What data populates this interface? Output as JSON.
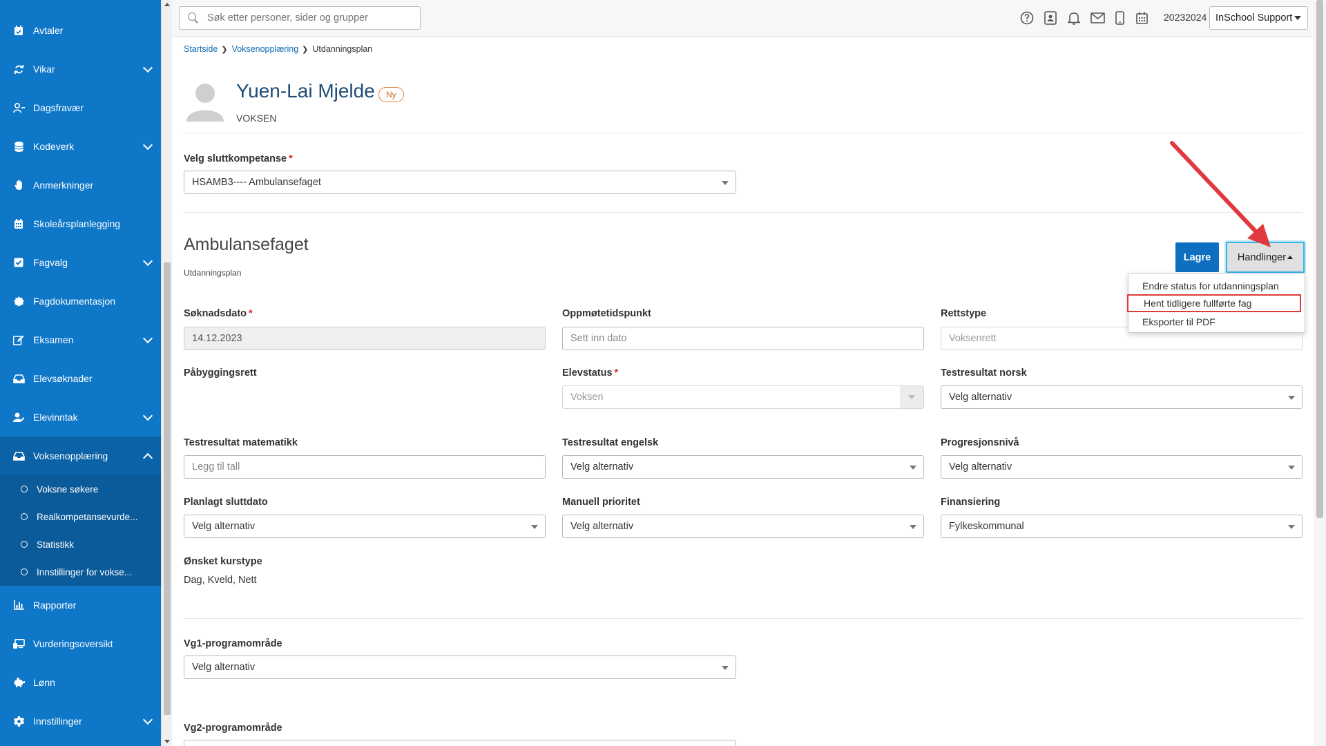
{
  "sidebar": {
    "items": [
      {
        "label": "Avtaler",
        "icon": "calendar-check-icon"
      },
      {
        "label": "Vikar",
        "icon": "sync-icon"
      },
      {
        "label": "Dagsfravær",
        "icon": "user-minus-icon"
      },
      {
        "label": "Kodeverk",
        "icon": "database-icon"
      },
      {
        "label": "Anmerkninger",
        "icon": "hand-icon"
      },
      {
        "label": "Skoleårsplanlegging",
        "icon": "calendar-icon"
      },
      {
        "label": "Fagvalg",
        "icon": "checkbox-icon"
      },
      {
        "label": "Fagdokumentasjon",
        "icon": "badge-icon"
      },
      {
        "label": "Eksamen",
        "icon": "edit-icon"
      },
      {
        "label": "Elevsøknader",
        "icon": "inbox-icon"
      },
      {
        "label": "Elevinntak",
        "icon": "user-edit-icon"
      },
      {
        "label": "Voksenopplæring",
        "icon": "inbox-icon"
      },
      {
        "label": "Rapporter",
        "icon": "chart-icon"
      },
      {
        "label": "Vurderingsoversikt",
        "icon": "monitor-icon"
      },
      {
        "label": "Lønn",
        "icon": "piggy-bank-icon"
      },
      {
        "label": "Innstillinger",
        "icon": "gear-icon"
      }
    ],
    "sub_items": [
      {
        "label": "Voksne søkere"
      },
      {
        "label": "Realkompetansevurde..."
      },
      {
        "label": "Statistikk"
      },
      {
        "label": "Innstillinger for vokse..."
      }
    ]
  },
  "header": {
    "search_placeholder": "Søk etter personer, sider og grupper",
    "school_year": "20232024",
    "user_menu": "InSchool Support"
  },
  "breadcrumb": [
    "Startside",
    "Voksenopplæring",
    "Utdanningsplan"
  ],
  "person": {
    "name": "Yuen-Lai Mjelde",
    "badge": "Ny",
    "role": "VOKSEN"
  },
  "competence": {
    "label": "Velg sluttkompetanse",
    "value": "HSAMB3---- Ambulansefaget"
  },
  "section": {
    "title": "Ambulansefaget",
    "subtitle": "Utdanningsplan"
  },
  "actions": {
    "save": "Lagre",
    "handlinger": "Handlinger",
    "menu": [
      "Endre status for utdanningsplan",
      "Hent tidligere fullførte fag",
      "Eksporter til PDF"
    ]
  },
  "form": {
    "soknadsdato": {
      "label": "Søknadsdato",
      "value": "14.12.2023"
    },
    "oppmote": {
      "label": "Oppmøtetidspunkt",
      "placeholder": "Sett inn dato"
    },
    "rettstype": {
      "label": "Rettstype",
      "value": "Voksenrett"
    },
    "pabygg": {
      "label": "Påbyggingsrett"
    },
    "elevstatus": {
      "label": "Elevstatus",
      "value": "Voksen"
    },
    "test_norsk": {
      "label": "Testresultat norsk",
      "value": "Velg alternativ"
    },
    "test_matte": {
      "label": "Testresultat matematikk",
      "placeholder": "Legg til tall"
    },
    "test_engelsk": {
      "label": "Testresultat engelsk",
      "value": "Velg alternativ"
    },
    "progresjon": {
      "label": "Progresjonsnivå",
      "value": "Velg alternativ"
    },
    "sluttdato": {
      "label": "Planlagt sluttdato",
      "value": "Velg alternativ"
    },
    "prioritet": {
      "label": "Manuell prioritet",
      "value": "Velg alternativ"
    },
    "finansiering": {
      "label": "Finansiering",
      "value": "Fylkeskommunal"
    },
    "kurstype": {
      "label": "Ønsket kurstype",
      "value": "Dag, Kveld, Nett"
    },
    "vg1": {
      "label": "Vg1-programområde",
      "value": "Velg alternativ"
    },
    "vg2": {
      "label": "Vg2-programområde"
    }
  },
  "colors": {
    "sidebar": "#0e77c8",
    "primary_button": "#0e6fc0",
    "highlight": "#e03b3b",
    "badge": "#e0813a"
  }
}
